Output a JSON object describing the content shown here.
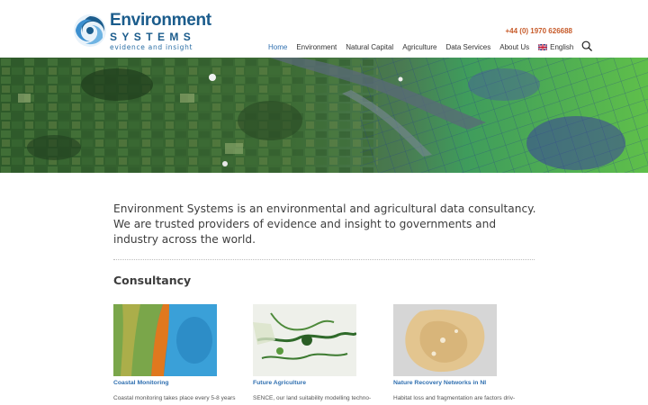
{
  "logo": {
    "word1": "Environment",
    "word2": "SYSTEMS",
    "tagline": "evidence and insight"
  },
  "header": {
    "phone": "+44 (0) 1970 626688"
  },
  "nav": {
    "items": [
      {
        "label": "Home",
        "active": true
      },
      {
        "label": "Environment",
        "active": false
      },
      {
        "label": "Natural Capital",
        "active": false
      },
      {
        "label": "Agriculture",
        "active": false
      },
      {
        "label": "Data Services",
        "active": false
      },
      {
        "label": "About Us",
        "active": false
      }
    ],
    "language": "English",
    "accent_color": "#2f6fb0"
  },
  "intro": {
    "text": "Environment Systems is an environmental and agricultural data consultancy. We are trusted providers of evidence and insight to governments and industry across the world."
  },
  "section": {
    "title": "Consultancy"
  },
  "cards": [
    {
      "title": "Coastal Monitoring",
      "text": "Coastal monitoring takes place every 5-8 years"
    },
    {
      "title": "Future Agriculture",
      "text": "SENCE, our land suitability modelling techno-"
    },
    {
      "title": "Nature Recovery Networks in NI",
      "text": "Habitat loss and fragmentation are factors driv-"
    }
  ]
}
